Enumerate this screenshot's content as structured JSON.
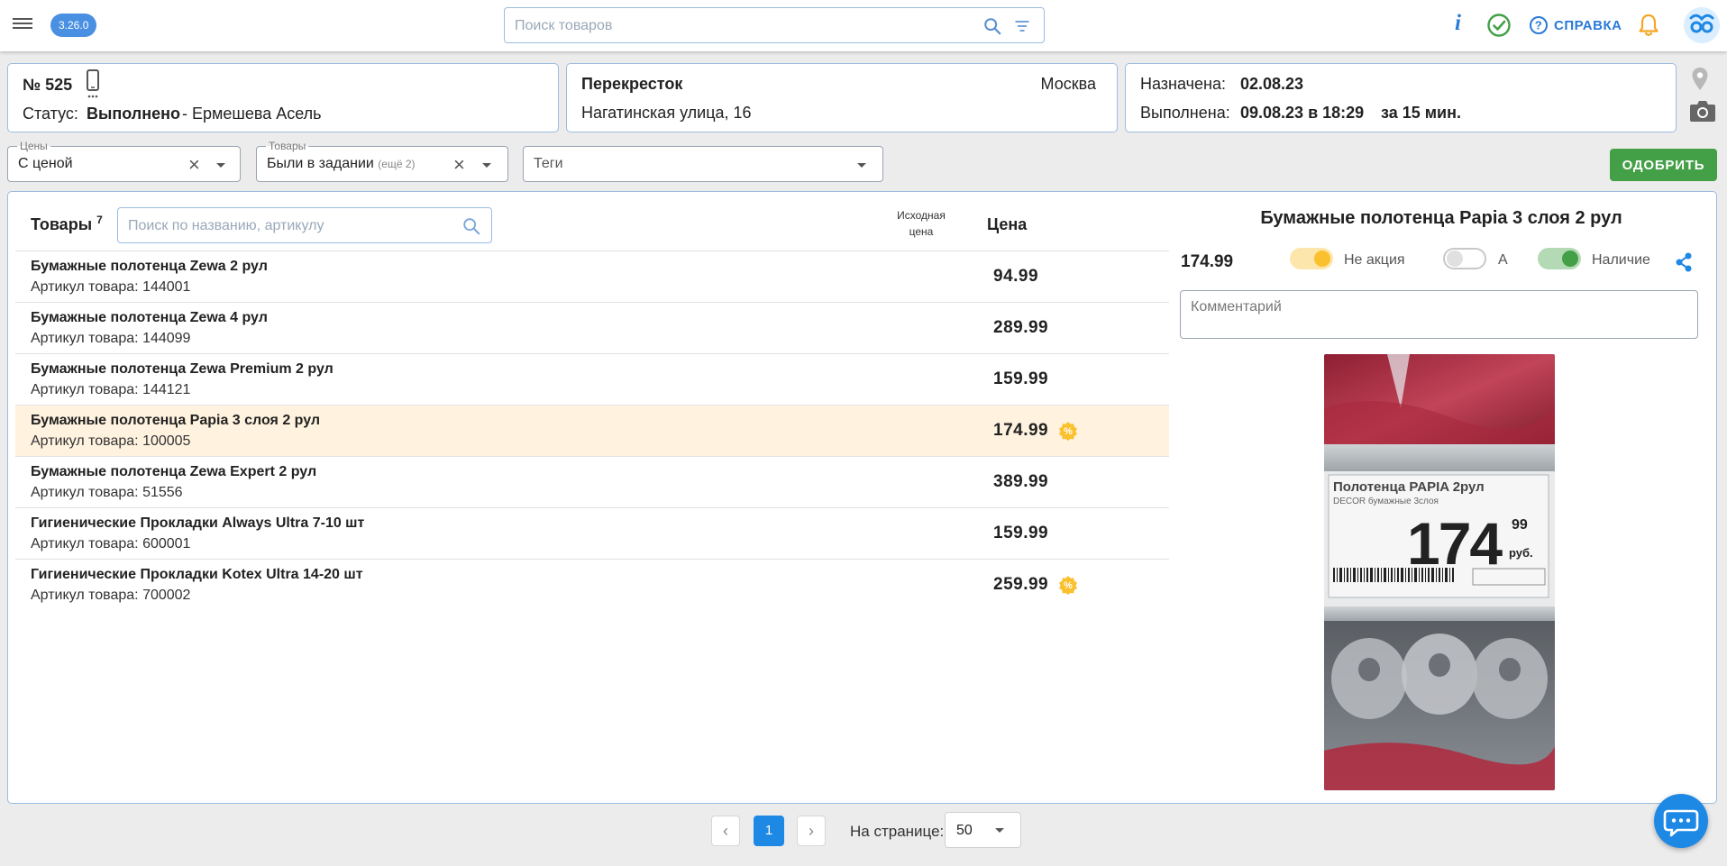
{
  "app": {
    "version": "3.26.0",
    "search_placeholder": "Поиск товаров",
    "help_label": "СПРАВКА"
  },
  "order": {
    "number": "№ 525",
    "status_label": "Статус:",
    "status_value": "Выполнено",
    "assignee": "- Ермешева Асель"
  },
  "store": {
    "name": "Перекресток",
    "city": "Москва",
    "address": "Нагатинская улица, 16"
  },
  "dates": {
    "assigned_label": "Назначена:",
    "assigned_value": "02.08.23",
    "completed_label": "Выполнена:",
    "completed_value": "09.08.23 в 18:29",
    "duration": "за 15 мин."
  },
  "filters": {
    "prices": {
      "legend": "Цены",
      "value": "С ценой"
    },
    "goods": {
      "legend": "Товары",
      "value": "Были в задании",
      "extra": "(ещё 2)"
    },
    "tags": {
      "placeholder": "Теги"
    },
    "approve_label": "ОДОБРИТЬ"
  },
  "goods": {
    "title": "Товары",
    "count": "7",
    "search_placeholder": "Поиск по названию, артикулу",
    "col_original_price": "Исходная цена",
    "col_price": "Цена",
    "sku_label": "Артикул товара:",
    "rows": [
      {
        "name": "Бумажные полотенца Zewa 2 рул",
        "sku": "144001",
        "price": "94.99",
        "promo": false,
        "selected": false
      },
      {
        "name": "Бумажные полотенца Zewa 4 рул",
        "sku": "144099",
        "price": "289.99",
        "promo": false,
        "selected": false
      },
      {
        "name": "Бумажные полотенца Zewa Premium 2 рул",
        "sku": "144121",
        "price": "159.99",
        "promo": false,
        "selected": false
      },
      {
        "name": "Бумажные полотенца Papia 3 слоя 2 рул",
        "sku": "100005",
        "price": "174.99",
        "promo": true,
        "selected": true
      },
      {
        "name": "Бумажные полотенца Zewa Expert 2 рул",
        "sku": "51556",
        "price": "389.99",
        "promo": false,
        "selected": false
      },
      {
        "name": "Гигиенические Прокладки Always Ultra 7-10 шт",
        "sku": "600001",
        "price": "159.99",
        "promo": false,
        "selected": false
      },
      {
        "name": "Гигиенические Прокладки Kotex Ultra 14-20 шт",
        "sku": "700002",
        "price": "259.99",
        "promo": true,
        "selected": false
      }
    ]
  },
  "detail": {
    "title": "Бумажные полотенца Papia 3 слоя 2 рул",
    "price": "174.99",
    "toggles": [
      {
        "label": "Не акция",
        "on": true,
        "color": "#fbc02d"
      },
      {
        "label": "А",
        "on": false,
        "color": "#9e9e9e"
      },
      {
        "label": "Наличие",
        "on": true,
        "color": "#43a047"
      }
    ],
    "comment_placeholder": "Комментарий",
    "photo": {
      "tag_title": "Полотенца PAPIA 2рул",
      "tag_subtitle": "DECOR бумажные 3слоя",
      "price_main": "174",
      "price_cents": "99",
      "currency": "руб."
    }
  },
  "pagination": {
    "current_page": "1",
    "per_page_label": "На странице:",
    "per_page_value": "50"
  },
  "colors": {
    "accent": "#1e88e5",
    "approve": "#43a047",
    "selected_row": "#fff3e0",
    "promo_badge": "#fbc02d"
  }
}
